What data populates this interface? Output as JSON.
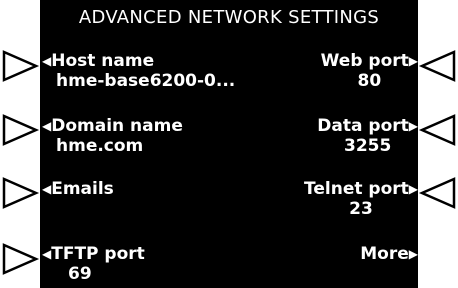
{
  "screen": {
    "title": "ADVANCED NETWORK SETTINGS",
    "left_items": [
      {
        "label": "Host name",
        "value": "hme-base6200-0..."
      },
      {
        "label": "Domain name",
        "value": "hme.com"
      },
      {
        "label": "Emails",
        "value": ""
      },
      {
        "label": "TFTP port",
        "value": "69"
      }
    ],
    "right_items": [
      {
        "label": "Web port",
        "value": "80"
      },
      {
        "label": "Data port",
        "value": "3255"
      },
      {
        "label": "Telnet port",
        "value": "23"
      },
      {
        "label": "More",
        "value": ""
      }
    ]
  },
  "icons": {
    "left_soft_key": "triangle-right-outline-icon",
    "right_soft_key": "triangle-left-outline-icon",
    "item_left_arrow": "small-left-arrow-icon",
    "item_right_arrow": "small-right-arrow-icon"
  },
  "colors": {
    "screen_bg": "#000000",
    "text": "#ffffff",
    "page_bg": "#ffffff",
    "softkey_outline": "#000000"
  }
}
